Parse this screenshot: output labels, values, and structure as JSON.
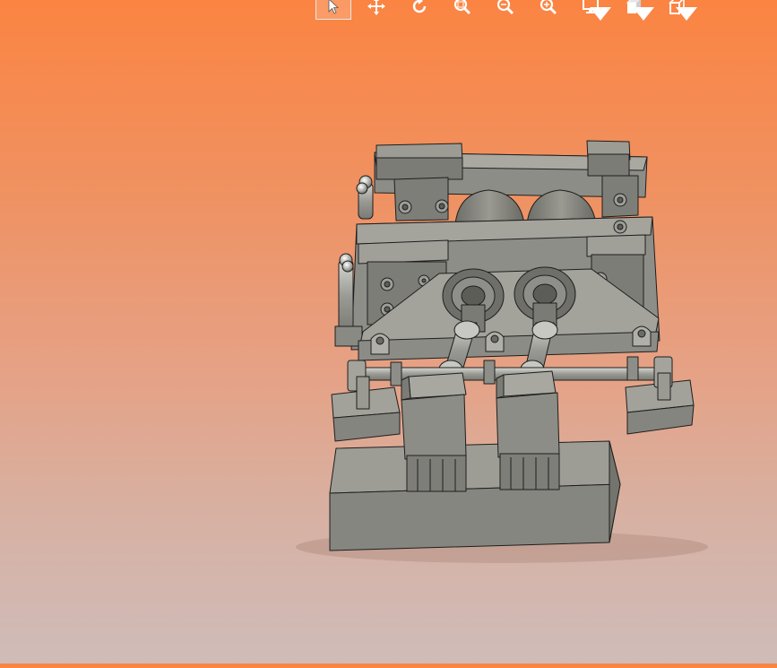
{
  "toolbar": {
    "tools": [
      {
        "name": "select-tool",
        "icon": "pointer-icon",
        "active": true
      },
      {
        "name": "pan-tool",
        "icon": "move-icon"
      },
      {
        "name": "rotate-tool",
        "icon": "rotate-icon"
      },
      {
        "name": "zoom-area-tool",
        "icon": "zoom-area-icon"
      },
      {
        "name": "zoom-in-out-tool",
        "icon": "zoom-in-out-icon"
      },
      {
        "name": "zoom-fit-tool",
        "icon": "zoom-fit-icon"
      },
      {
        "name": "display-mode-tool",
        "icon": "monitor-icon",
        "has_dropdown": true
      },
      {
        "name": "view-orientation-tool",
        "icon": "view-cube-icon",
        "has_dropdown": true
      },
      {
        "name": "section-view-tool",
        "icon": "section-icon",
        "has_dropdown": true
      }
    ]
  },
  "viewport": {
    "background_top": "#fb8442",
    "background_bottom": "#cfbcb9",
    "model_color": "#8a8a84",
    "edge_color": "#1e1e1e"
  }
}
